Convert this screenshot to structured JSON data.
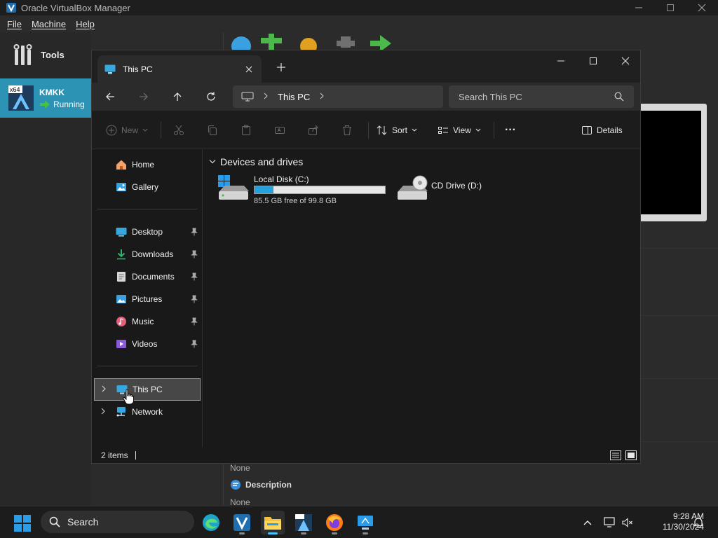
{
  "vbox": {
    "title": "Oracle VirtualBox Manager",
    "menu": [
      "File",
      "Machine",
      "Help"
    ],
    "tools_label": "Tools",
    "vm": {
      "name": "KMKK",
      "state": "Running",
      "arch_badge": "x64"
    },
    "details": {
      "none_1": "None",
      "description_heading": "Description",
      "none_2": "None"
    }
  },
  "explorer": {
    "tab_title": "This PC",
    "address": {
      "crumb": "This PC"
    },
    "search_placeholder": "Search This PC",
    "commands": {
      "new": "New",
      "sort": "Sort",
      "view": "View",
      "more": "···",
      "details": "Details"
    },
    "nav": {
      "top": [
        {
          "label": "Home",
          "icon": "home-icon"
        },
        {
          "label": "Gallery",
          "icon": "gallery-icon"
        }
      ],
      "pinned": [
        {
          "label": "Desktop",
          "icon": "desktop-folder-icon"
        },
        {
          "label": "Downloads",
          "icon": "downloads-folder-icon"
        },
        {
          "label": "Documents",
          "icon": "documents-folder-icon"
        },
        {
          "label": "Pictures",
          "icon": "pictures-folder-icon"
        },
        {
          "label": "Music",
          "icon": "music-folder-icon"
        },
        {
          "label": "Videos",
          "icon": "videos-folder-icon"
        }
      ],
      "bottom": [
        {
          "label": "This PC",
          "icon": "this-pc-icon",
          "selected": true
        },
        {
          "label": "Network",
          "icon": "network-icon",
          "selected": false
        }
      ]
    },
    "group_heading": "Devices and drives",
    "drives": [
      {
        "name": "Local Disk (C:)",
        "free_text": "85.5 GB free of 99.8 GB",
        "used_fraction": 0.143,
        "icon": "local-disk-icon"
      },
      {
        "name": "CD Drive (D:)",
        "icon": "cd-drive-icon"
      }
    ],
    "status": {
      "items": "2 items"
    }
  },
  "taskbar": {
    "search_label": "Search",
    "time": "9:28 AM",
    "date": "11/30/2024",
    "apps": [
      "edge-icon",
      "virtualbox-icon",
      "file-explorer-icon",
      "x64-vm-icon",
      "firefox-icon",
      "remote-desktop-icon"
    ]
  },
  "colors": {
    "accent": "#26a0da",
    "vm_selected": "#2c93b4",
    "taskbar_active": "#4cc2ff"
  }
}
